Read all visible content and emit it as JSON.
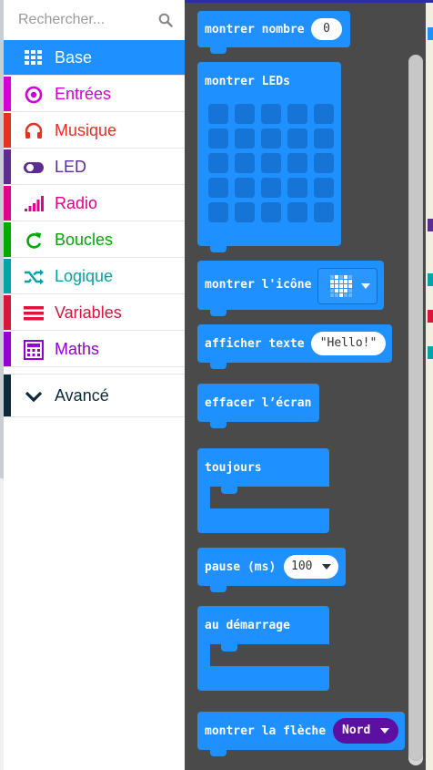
{
  "search": {
    "placeholder": "Rechercher..."
  },
  "categories": [
    {
      "label": "Base",
      "color": "#1e90ff",
      "icon": "grid-icon"
    },
    {
      "label": "Entrées",
      "color": "#d400d4",
      "icon": "target-icon"
    },
    {
      "label": "Musique",
      "color": "#e63022",
      "icon": "headphones-icon"
    },
    {
      "label": "LED",
      "color": "#5c2d91",
      "icon": "toggle-icon"
    },
    {
      "label": "Radio",
      "color": "#e3008c",
      "icon": "signal-icon"
    },
    {
      "label": "Boucles",
      "color": "#00aa00",
      "icon": "loop-icon"
    },
    {
      "label": "Logique",
      "color": "#00a4a6",
      "icon": "shuffle-icon"
    },
    {
      "label": "Variables",
      "color": "#dc143c",
      "icon": "list-icon"
    },
    {
      "label": "Maths",
      "color": "#9400d3",
      "icon": "calculator-icon"
    }
  ],
  "advanced": {
    "label": "Avancé",
    "color": "#0b2b3a",
    "icon": "chevron-down-icon"
  },
  "blocks": {
    "show_number": {
      "label": "montrer nombre",
      "value": "0"
    },
    "show_leds": {
      "label": "montrer LEDs"
    },
    "show_icon": {
      "label": "montrer l'icône",
      "icon": "heart-icon"
    },
    "show_string": {
      "label": "afficher texte",
      "value": "Hello!"
    },
    "clear_screen": {
      "label": "effacer l’écran"
    },
    "forever": {
      "label": "toujours"
    },
    "pause": {
      "label": "pause (ms)",
      "value": "100"
    },
    "on_start": {
      "label": "au démarrage"
    },
    "show_arrow": {
      "label": "montrer la flèche",
      "value": "Nord"
    }
  },
  "colors": {
    "base": "#1e90ff",
    "workspace": "#4a4a4a",
    "arrow_dropdown": "#5c0fa0"
  }
}
